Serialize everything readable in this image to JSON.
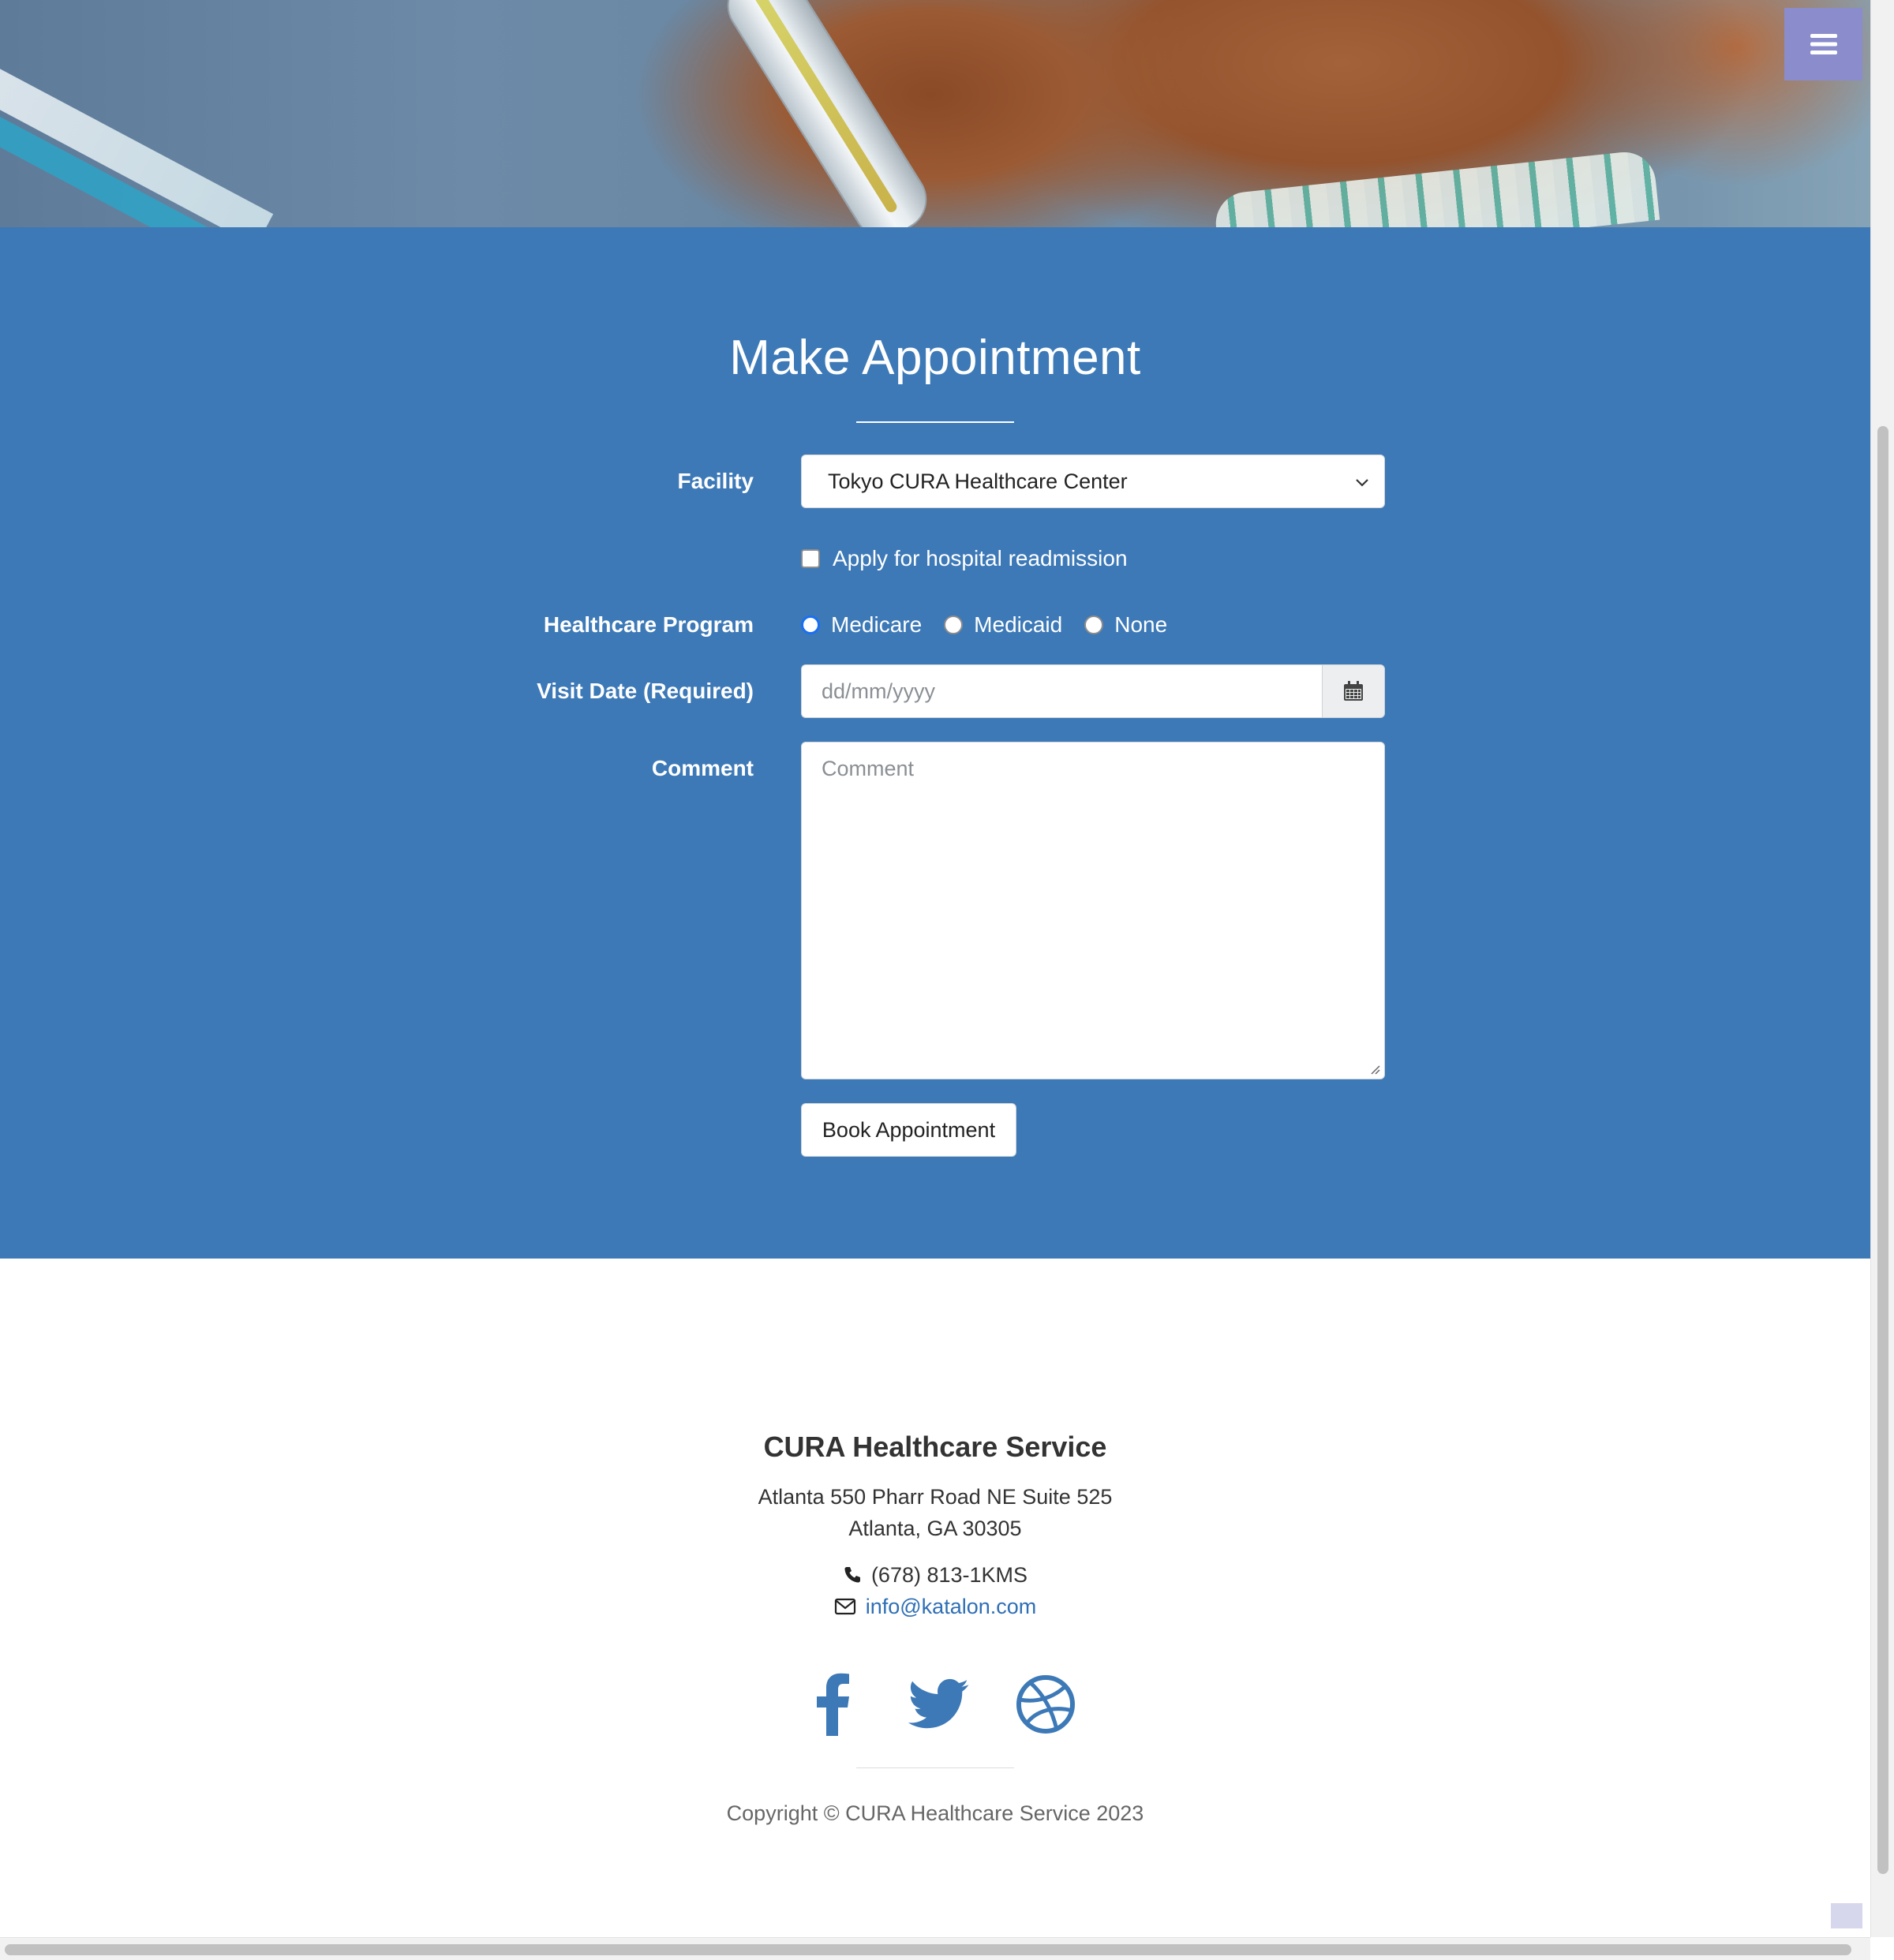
{
  "header": {
    "menu_icon": "hamburger-menu-icon",
    "accent_color": "#8a8ccc"
  },
  "appointment": {
    "title": "Make Appointment",
    "section_color": "#3d79b7",
    "facility": {
      "label": "Facility",
      "selected": "Tokyo CURA Healthcare Center"
    },
    "readmission": {
      "label": "Apply for hospital readmission",
      "checked": false
    },
    "program": {
      "label": "Healthcare Program",
      "options": [
        "Medicare",
        "Medicaid",
        "None"
      ],
      "selected": "Medicare"
    },
    "visit_date": {
      "label": "Visit Date (Required)",
      "placeholder": "dd/mm/yyyy",
      "icon": "calendar-icon"
    },
    "comment": {
      "label": "Comment",
      "placeholder": "Comment"
    },
    "book_button": "Book Appointment"
  },
  "footer": {
    "company": "CURA Healthcare Service",
    "address_line1": "Atlanta 550 Pharr Road NE Suite 525",
    "address_line2": "Atlanta, GA 30305",
    "phone": "(678) 813-1KMS",
    "email": "info@katalon.com",
    "social": [
      "facebook-icon",
      "twitter-icon",
      "dribbble-icon"
    ],
    "social_color": "#3d79b7",
    "copyright": "Copyright © CURA Healthcare Service 2023"
  }
}
